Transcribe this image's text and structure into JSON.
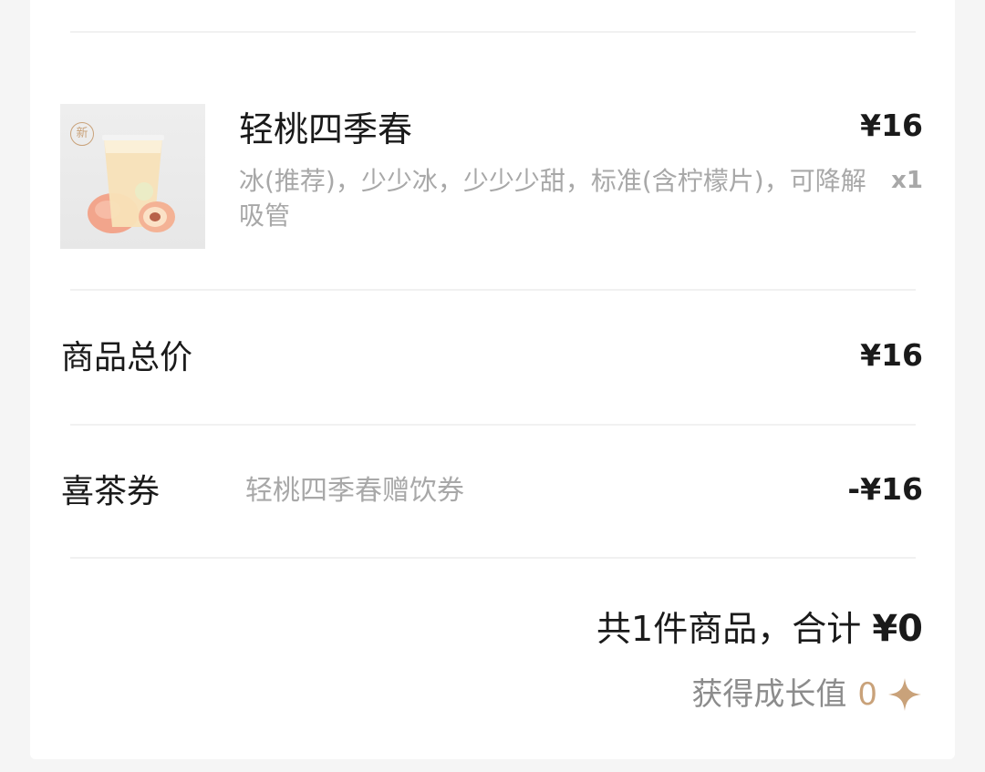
{
  "product": {
    "badge": "新",
    "name": "轻桃四季春",
    "price": "¥16",
    "spec": "冰(推荐)，少少冰，少少少甜，标准(含柠檬片)，可降解吸管",
    "quantity": "x1"
  },
  "subtotal": {
    "label": "商品总价",
    "value": "¥16"
  },
  "coupon": {
    "label": "喜茶券",
    "description": "轻桃四季春赠饮券",
    "value": "-¥16"
  },
  "summary": {
    "count_text": "共1件商品，合计",
    "total": "¥0"
  },
  "growth": {
    "label": "获得成长值",
    "value": "0",
    "icon": "sparkle-icon"
  },
  "colors": {
    "accent": "#c9a27a",
    "text_primary": "#1a1a1a",
    "text_secondary": "#a8a8a8",
    "divider": "#f1f1f1",
    "background": "#f5f5f5"
  }
}
